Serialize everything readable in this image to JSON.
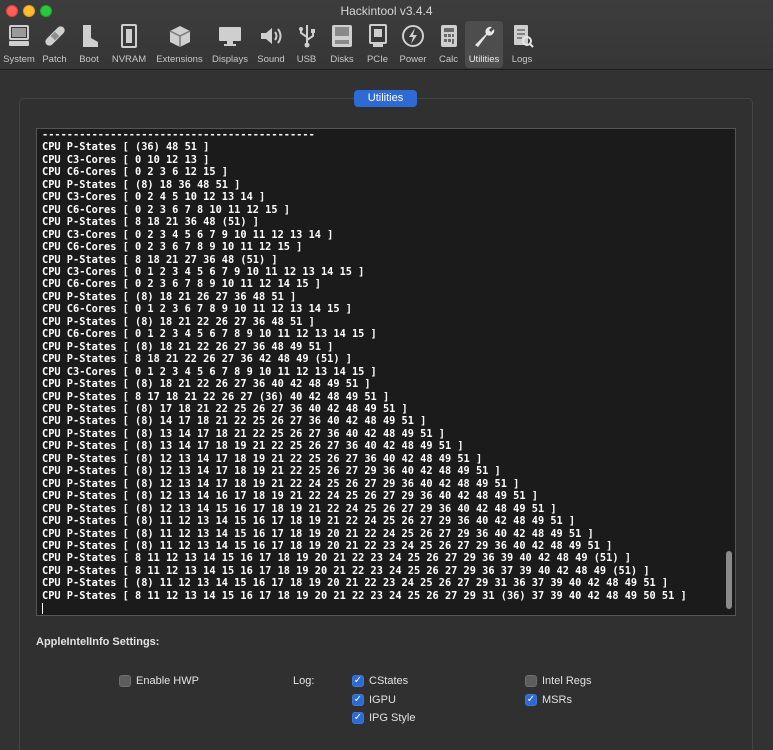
{
  "window": {
    "title": "Hackintool v3.4.4"
  },
  "toolbar": {
    "items": [
      {
        "label": "System",
        "icon": "computer-icon"
      },
      {
        "label": "Patch",
        "icon": "bandage-icon"
      },
      {
        "label": "Boot",
        "icon": "boot-icon"
      },
      {
        "label": "NVRAM",
        "icon": "memory-chip-icon"
      },
      {
        "label": "Extensions",
        "icon": "box-icon"
      },
      {
        "label": "Displays",
        "icon": "monitor-icon"
      },
      {
        "label": "Sound",
        "icon": "speaker-icon"
      },
      {
        "label": "USB",
        "icon": "usb-icon"
      },
      {
        "label": "Disks",
        "icon": "disk-icon"
      },
      {
        "label": "PCIe",
        "icon": "pci-card-icon"
      },
      {
        "label": "Power",
        "icon": "power-bolt-icon"
      },
      {
        "label": "Calc",
        "icon": "calculator-icon"
      },
      {
        "label": "Utilities",
        "icon": "wrench-icon"
      },
      {
        "label": "Logs",
        "icon": "logs-icon"
      }
    ],
    "active": "Utilities"
  },
  "tab": {
    "label": "Utilities"
  },
  "terminal": {
    "lines": [
      "--------------------------------------------",
      "CPU P-States [ (36) 48 51 ]",
      "CPU C3-Cores [ 0 10 12 13 ]",
      "CPU C6-Cores [ 0 2 3 6 12 15 ]",
      "CPU P-States [ (8) 18 36 48 51 ]",
      "CPU C3-Cores [ 0 2 4 5 10 12 13 14 ]",
      "CPU C6-Cores [ 0 2 3 6 7 8 10 11 12 15 ]",
      "CPU P-States [ 8 18 21 36 48 (51) ]",
      "CPU C3-Cores [ 0 2 3 4 5 6 7 9 10 11 12 13 14 ]",
      "CPU C6-Cores [ 0 2 3 6 7 8 9 10 11 12 15 ]",
      "CPU P-States [ 8 18 21 27 36 48 (51) ]",
      "CPU C3-Cores [ 0 1 2 3 4 5 6 7 9 10 11 12 13 14 15 ]",
      "CPU C6-Cores [ 0 2 3 6 7 8 9 10 11 12 14 15 ]",
      "CPU P-States [ (8) 18 21 26 27 36 48 51 ]",
      "CPU C6-Cores [ 0 1 2 3 6 7 8 9 10 11 12 13 14 15 ]",
      "CPU P-States [ (8) 18 21 22 26 27 36 48 51 ]",
      "CPU C6-Cores [ 0 1 2 3 4 5 6 7 8 9 10 11 12 13 14 15 ]",
      "CPU P-States [ (8) 18 21 22 26 27 36 48 49 51 ]",
      "CPU P-States [ 8 18 21 22 26 27 36 42 48 49 (51) ]",
      "CPU C3-Cores [ 0 1 2 3 4 5 6 7 8 9 10 11 12 13 14 15 ]",
      "CPU P-States [ (8) 18 21 22 26 27 36 40 42 48 49 51 ]",
      "CPU P-States [ 8 17 18 21 22 26 27 (36) 40 42 48 49 51 ]",
      "CPU P-States [ (8) 17 18 21 22 25 26 27 36 40 42 48 49 51 ]",
      "CPU P-States [ (8) 14 17 18 21 22 25 26 27 36 40 42 48 49 51 ]",
      "CPU P-States [ (8) 13 14 17 18 21 22 25 26 27 36 40 42 48 49 51 ]",
      "CPU P-States [ (8) 13 14 17 18 19 21 22 25 26 27 36 40 42 48 49 51 ]",
      "CPU P-States [ (8) 12 13 14 17 18 19 21 22 25 26 27 36 40 42 48 49 51 ]",
      "CPU P-States [ (8) 12 13 14 17 18 19 21 22 25 26 27 29 36 40 42 48 49 51 ]",
      "CPU P-States [ (8) 12 13 14 17 18 19 21 22 24 25 26 27 29 36 40 42 48 49 51 ]",
      "CPU P-States [ (8) 12 13 14 16 17 18 19 21 22 24 25 26 27 29 36 40 42 48 49 51 ]",
      "CPU P-States [ (8) 12 13 14 15 16 17 18 19 21 22 24 25 26 27 29 36 40 42 48 49 51 ]",
      "CPU P-States [ (8) 11 12 13 14 15 16 17 18 19 21 22 24 25 26 27 29 36 40 42 48 49 51 ]",
      "CPU P-States [ (8) 11 12 13 14 15 16 17 18 19 20 21 22 24 25 26 27 29 36 40 42 48 49 51 ]",
      "CPU P-States [ (8) 11 12 13 14 15 16 17 18 19 20 21 22 23 24 25 26 27 29 36 40 42 48 49 51 ]",
      "CPU P-States [ 8 11 12 13 14 15 16 17 18 19 20 21 22 23 24 25 26 27 29 36 39 40 42 48 49 (51) ]",
      "CPU P-States [ 8 11 12 13 14 15 16 17 18 19 20 21 22 23 24 25 26 27 29 36 37 39 40 42 48 49 (51) ]",
      "CPU P-States [ (8) 11 12 13 14 15 16 17 18 19 20 21 22 23 24 25 26 27 29 31 36 37 39 40 42 48 49 51 ]",
      "CPU P-States [ 8 11 12 13 14 15 16 17 18 19 20 21 22 23 24 25 26 27 29 31 (36) 37 39 40 42 48 49 50 51 ]"
    ]
  },
  "settings": {
    "heading": "AppleIntelInfo Settings:",
    "enable_hwp": {
      "label": "Enable HWP",
      "checked": false
    },
    "log_label": "Log:",
    "cstates": {
      "label": "CStates",
      "checked": true
    },
    "igpu": {
      "label": "IGPU",
      "checked": true
    },
    "ipg_style": {
      "label": "IPG Style",
      "checked": true
    },
    "intel_regs": {
      "label": "Intel Regs",
      "checked": false
    },
    "msrs": {
      "label": "MSRs",
      "checked": true
    }
  },
  "colors": {
    "accent": "#2d6ad4",
    "close": "#fe5f57",
    "minimize": "#febc2e",
    "maximize": "#28c840"
  }
}
